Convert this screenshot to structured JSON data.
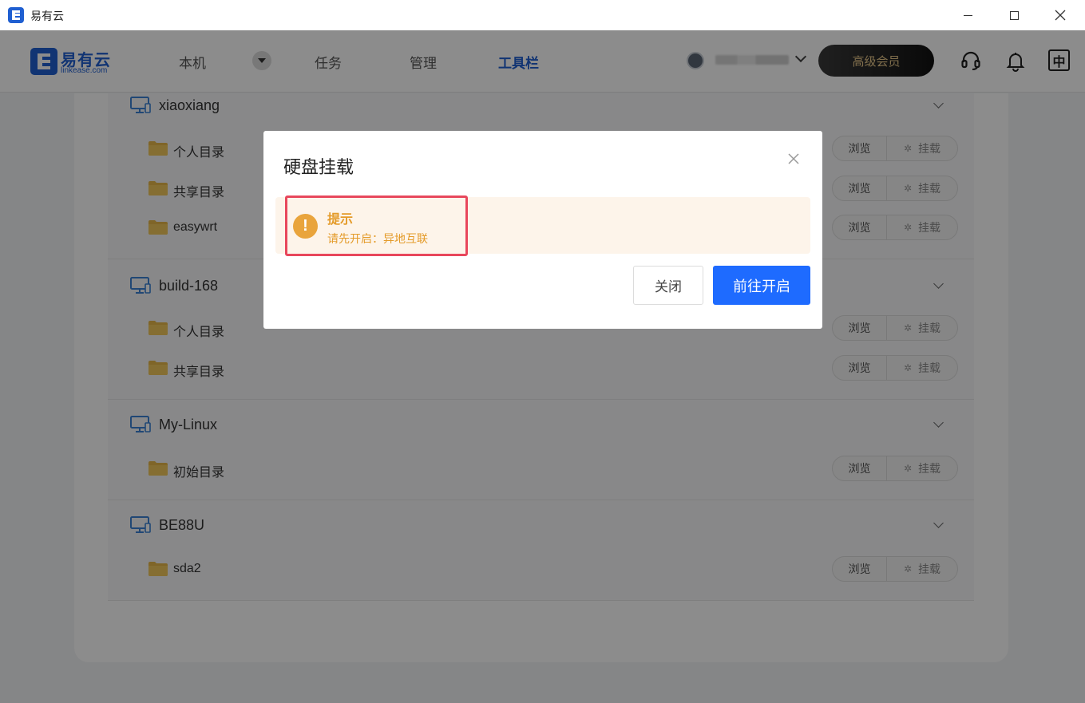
{
  "window": {
    "title": "易有云"
  },
  "header": {
    "logo_text": "易有云",
    "logo_sub": "linkease.com",
    "nav": [
      {
        "label": "本机"
      },
      {
        "label": "任务"
      },
      {
        "label": "管理"
      },
      {
        "label": "工具栏",
        "active": true
      }
    ],
    "vip_label": "高级会员",
    "lang_label": "中"
  },
  "devices": [
    {
      "name": "xiaoxiang",
      "dirs": [
        {
          "name": "个人目录"
        },
        {
          "name": "共享目录"
        },
        {
          "name": "easywrt"
        }
      ]
    },
    {
      "name": "build-168",
      "dirs": [
        {
          "name": "个人目录"
        },
        {
          "name": "共享目录"
        }
      ]
    },
    {
      "name": "My-Linux",
      "dirs": [
        {
          "name": "初始目录"
        }
      ]
    },
    {
      "name": "BE88U",
      "dirs": [
        {
          "name": "sda2"
        }
      ]
    }
  ],
  "actions": {
    "browse": "浏览",
    "mount": "挂载"
  },
  "modal": {
    "title": "硬盘挂载",
    "alert_title": "提示",
    "alert_message": "请先开启：异地互联",
    "close_label": "关闭",
    "confirm_label": "前往开启"
  },
  "colors": {
    "brand": "#1f5fd1",
    "primary_button": "#1e6bff",
    "warning": "#e49b2a",
    "highlight": "#e8475c"
  }
}
